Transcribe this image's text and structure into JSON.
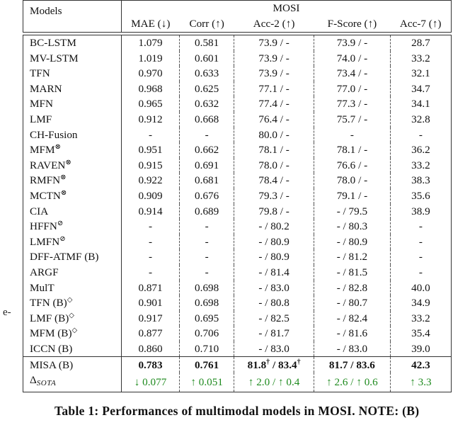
{
  "stray_text": "e-",
  "table": {
    "header": {
      "models_label": "Models",
      "dataset_label": "MOSI",
      "metrics": [
        "MAE (↓)",
        "Corr (↑)",
        "Acc-2 (↑)",
        "F-Score (↑)",
        "Acc-7 (↑)"
      ]
    },
    "rows": [
      {
        "model": "BC-LSTM",
        "mark": "",
        "mae": "1.079",
        "corr": "0.581",
        "acc2": "73.9 / -",
        "f": "73.9 / -",
        "acc7": "28.7"
      },
      {
        "model": "MV-LSTM",
        "mark": "",
        "mae": "1.019",
        "corr": "0.601",
        "acc2": "73.9 / -",
        "f": "74.0 / -",
        "acc7": "33.2"
      },
      {
        "model": "TFN",
        "mark": "",
        "mae": "0.970",
        "corr": "0.633",
        "acc2": "73.9 / -",
        "f": "73.4 / -",
        "acc7": "32.1"
      },
      {
        "model": "MARN",
        "mark": "",
        "mae": "0.968",
        "corr": "0.625",
        "acc2": "77.1 / -",
        "f": "77.0 / -",
        "acc7": "34.7"
      },
      {
        "model": "MFN",
        "mark": "",
        "mae": "0.965",
        "corr": "0.632",
        "acc2": "77.4 / -",
        "f": "77.3 / -",
        "acc7": "34.1"
      },
      {
        "model": "LMF",
        "mark": "",
        "mae": "0.912",
        "corr": "0.668",
        "acc2": "76.4 / -",
        "f": "75.7 / -",
        "acc7": "32.8"
      },
      {
        "model": "CH-Fusion",
        "mark": "",
        "mae": "-",
        "corr": "-",
        "acc2": "80.0 / -",
        "f": "-",
        "acc7": "-"
      },
      {
        "model": "MFM",
        "mark": "⊗",
        "mae": "0.951",
        "corr": "0.662",
        "acc2": "78.1 / -",
        "f": "78.1 / -",
        "acc7": "36.2"
      },
      {
        "model": "RAVEN",
        "mark": "⊗",
        "mae": "0.915",
        "corr": "0.691",
        "acc2": "78.0 / -",
        "f": "76.6 / -",
        "acc7": "33.2"
      },
      {
        "model": "RMFN",
        "mark": "⊗",
        "mae": "0.922",
        "corr": "0.681",
        "acc2": "78.4 / -",
        "f": "78.0 / -",
        "acc7": "38.3"
      },
      {
        "model": "MCTN",
        "mark": "⊗",
        "mae": "0.909",
        "corr": "0.676",
        "acc2": "79.3 / -",
        "f": "79.1 / -",
        "acc7": "35.6"
      },
      {
        "model": "CIA",
        "mark": "",
        "mae": "0.914",
        "corr": "0.689",
        "acc2": "79.8 / -",
        "f": "- / 79.5",
        "acc7": "38.9"
      },
      {
        "model": "HFFN",
        "mark": "⊘",
        "mae": "-",
        "corr": "-",
        "acc2": "- / 80.2",
        "f": "- / 80.3",
        "acc7": "-"
      },
      {
        "model": "LMFN",
        "mark": "⊘",
        "mae": "-",
        "corr": "-",
        "acc2": "- / 80.9",
        "f": "- / 80.9",
        "acc7": "-"
      },
      {
        "model": "DFF-ATMF (B)",
        "mark": "",
        "mae": "-",
        "corr": "-",
        "acc2": "- / 80.9",
        "f": "- / 81.2",
        "acc7": "-"
      },
      {
        "model": "ARGF",
        "mark": "",
        "mae": "-",
        "corr": "-",
        "acc2": "- / 81.4",
        "f": "- / 81.5",
        "acc7": "-"
      },
      {
        "model": "MulT",
        "mark": "",
        "mae": "0.871",
        "corr": "0.698",
        "acc2": "- / 83.0",
        "f": "- / 82.8",
        "acc7": "40.0"
      },
      {
        "model": "TFN (B)",
        "mark": "◇",
        "mae": "0.901",
        "corr": "0.698",
        "acc2": "- / 80.8",
        "f": "- / 80.7",
        "acc7": "34.9"
      },
      {
        "model": "LMF (B)",
        "mark": "◇",
        "mae": "0.917",
        "corr": "0.695",
        "acc2": "- / 82.5",
        "f": "- / 82.4",
        "acc7": "33.2"
      },
      {
        "model": "MFM (B)",
        "mark": "◇",
        "mae": "0.877",
        "corr": "0.706",
        "acc2": "- / 81.7",
        "f": "- / 81.6",
        "acc7": "35.4"
      },
      {
        "model": "ICCN (B)",
        "mark": "",
        "mae": "0.860",
        "corr": "0.710",
        "acc2": "- / 83.0",
        "f": "- / 83.0",
        "acc7": "39.0"
      }
    ],
    "misa": {
      "model": "MISA (B)",
      "mae": "0.783",
      "corr": "0.761",
      "acc2_a": "81.8",
      "acc2_sep": " / ",
      "acc2_b": "83.4",
      "dagger": "†",
      "f": "81.7 / 83.6",
      "acc7": "42.3"
    },
    "delta": {
      "label_main": "Δ",
      "label_sub": "SOTA",
      "mae": "↓ 0.077",
      "corr": "↑ 0.051",
      "acc2": "↑ 2.0 / ↑ 0.4",
      "f": "↑ 2.6 / ↑ 0.6",
      "acc7": "↑ 3.3",
      "color": "#1e8a1e"
    }
  },
  "caption": "Table 1: Performances of multimodal models in MOSI. NOTE: (B)"
}
